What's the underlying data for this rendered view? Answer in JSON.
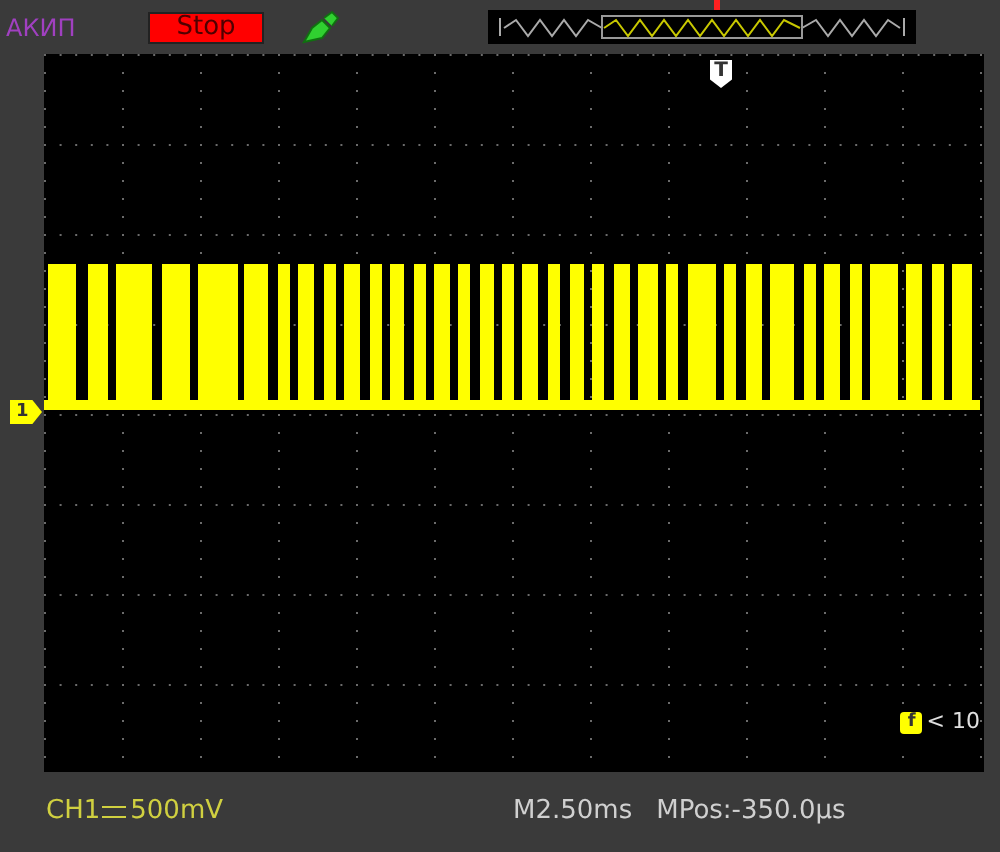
{
  "top_bar": {
    "brand": "АКИП",
    "run_status": "Stop"
  },
  "screen": {
    "trigger_marker": "T",
    "channel_marker": "1"
  },
  "trigger_readout": {
    "icon_letter": "f",
    "value": "< 10"
  },
  "status_bar": {
    "channel": "CH1",
    "volts_per_div": "500mV",
    "timebase": "M2.50ms",
    "position": "MPos:-350.0µs"
  }
}
